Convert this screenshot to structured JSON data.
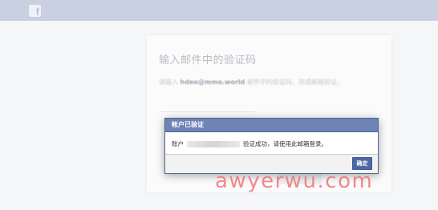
{
  "topbar": {
    "logo_icon": "facebook-f-icon",
    "logo_letter": "f",
    "color": "#c8d0e2"
  },
  "card": {
    "title": "输入邮件中的验证码",
    "text_before": "请输入",
    "email": "hdeo@mmo.world",
    "text_after": "邮件中的验证码，完成邮箱验证。"
  },
  "dialog": {
    "title": "帐户已验证",
    "message_prefix": "账户",
    "message_suffix": "验证成功，请使用此邮箱登录。",
    "confirm_label": "确定",
    "header_color": "#6d84b4",
    "button_color": "#4e69a2"
  },
  "watermark": {
    "text": "awyerwu.com",
    "color": "#ef7676"
  }
}
